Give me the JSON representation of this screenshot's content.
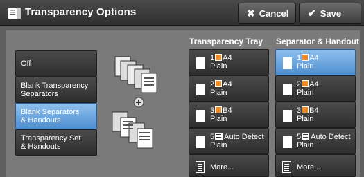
{
  "header": {
    "title": "Transparency Options",
    "cancel_label": "Cancel",
    "save_label": "Save"
  },
  "left_options": [
    {
      "label": "Off",
      "selected": false
    },
    {
      "label": "Blank Transparency\nSeparators",
      "selected": false
    },
    {
      "label": "Blank Separators\n& Handouts",
      "selected": true
    },
    {
      "label": "Transparency Set\n& Handouts",
      "selected": false
    }
  ],
  "tray_column": {
    "label": "Transparency Tray",
    "items": [
      {
        "num": "1",
        "size": "A4",
        "type": "Plain",
        "icon": "tray-icon",
        "selected": false
      },
      {
        "num": "2",
        "size": "A4",
        "type": "Plain",
        "icon": "tray-icon",
        "selected": false
      },
      {
        "num": "3",
        "size": "B4",
        "type": "Plain",
        "icon": "tray-icon",
        "selected": false
      },
      {
        "num": "5",
        "size": "Auto Detect",
        "type": "Plain",
        "icon": "bypass-tray-icon",
        "selected": false
      }
    ],
    "more_label": "More..."
  },
  "separator_column": {
    "label": "Separator & Handout",
    "items": [
      {
        "num": "1",
        "size": "A4",
        "type": "Plain",
        "icon": "tray-icon",
        "selected": true
      },
      {
        "num": "2",
        "size": "A4",
        "type": "Plain",
        "icon": "tray-icon",
        "selected": false
      },
      {
        "num": "3",
        "size": "B4",
        "type": "Plain",
        "icon": "tray-icon",
        "selected": false
      },
      {
        "num": "5",
        "size": "Auto Detect",
        "type": "Plain",
        "icon": "bypass-tray-icon",
        "selected": false
      }
    ],
    "more_label": "More..."
  },
  "colors": {
    "accent": "#5b9be0",
    "tray_icon": "#f08a24"
  }
}
